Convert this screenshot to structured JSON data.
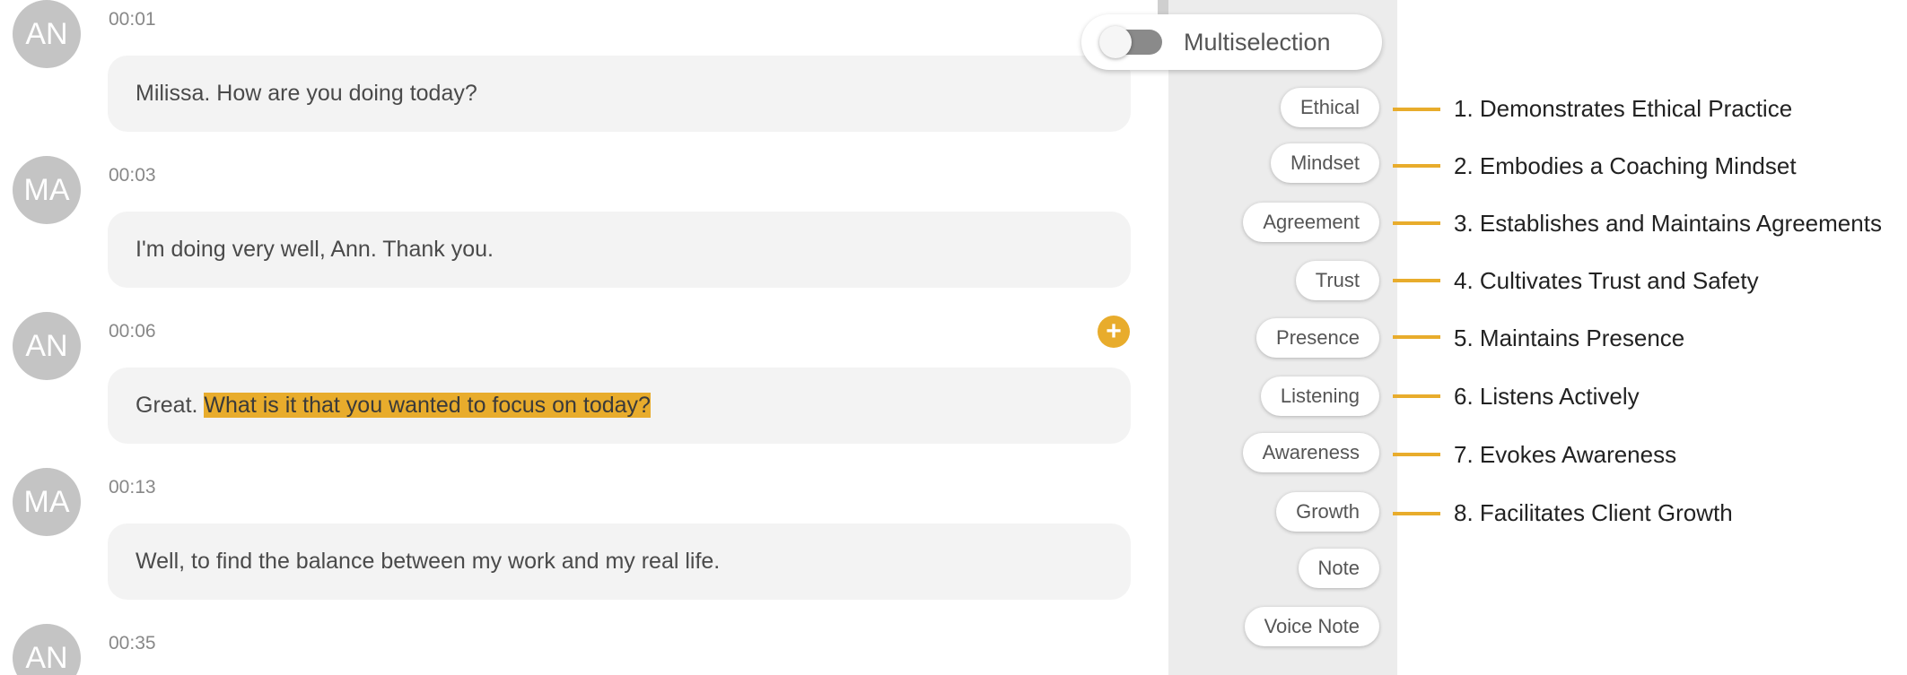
{
  "messages": [
    {
      "speaker": "AN",
      "time": "00:01",
      "text": "Milissa. How are you doing today?"
    },
    {
      "speaker": "MA",
      "time": "00:03",
      "text": "I'm doing very well, Ann. Thank you."
    },
    {
      "speaker": "AN",
      "time": "00:06",
      "text_before": "Great. ",
      "text_highlight": "What is it that you wanted to focus on today?"
    },
    {
      "speaker": "MA",
      "time": "00:13",
      "text": "Well, to find the balance between my work and my real life."
    },
    {
      "speaker": "AN",
      "time": "00:35"
    }
  ],
  "add_button_icon": "plus-icon",
  "panel": {
    "multiselection_label": "Multiselection",
    "multiselection_on": false,
    "tags": [
      "Ethical",
      "Mindset",
      "Agreement",
      "Trust",
      "Presence",
      "Listening",
      "Awareness",
      "Growth",
      "Note",
      "Voice Note"
    ]
  },
  "callouts": [
    "1. Demonstrates Ethical Practice",
    "2. Embodies a Coaching Mindset",
    "3. Establishes and Maintains Agreements",
    "4. Cultivates Trust and Safety",
    "5. Maintains Presence",
    "6. Listens Actively",
    "7. Evokes Awareness",
    "8. Facilitates Client Growth"
  ],
  "colors": {
    "accent": "#e8ac2c",
    "avatar": "#c4c4c4",
    "bubble": "#f3f3f3",
    "panel": "#ececec"
  }
}
